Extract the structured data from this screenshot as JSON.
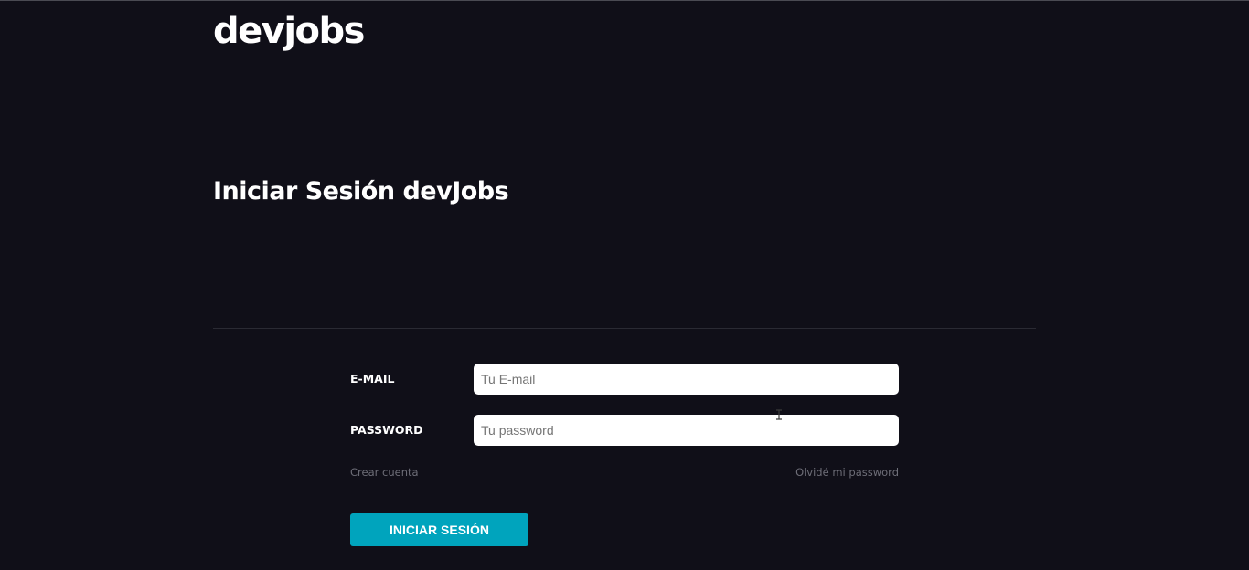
{
  "header": {
    "logo": "devjobs"
  },
  "main": {
    "title": "Iniciar Sesión devJobs"
  },
  "form": {
    "email": {
      "label": "E-MAIL",
      "placeholder": "Tu E-mail",
      "value": ""
    },
    "password": {
      "label": "PASSWORD",
      "placeholder": "Tu password",
      "value": ""
    },
    "create_account_link": "Crear cuenta",
    "forgot_password_link": "Olvidé mi password",
    "submit_label": "INICIAR SESIÓN"
  },
  "colors": {
    "background": "#100f18",
    "accent": "#00a4bd",
    "link": "#6e6e78"
  },
  "icons": {
    "cursor": "text-cursor-icon"
  }
}
